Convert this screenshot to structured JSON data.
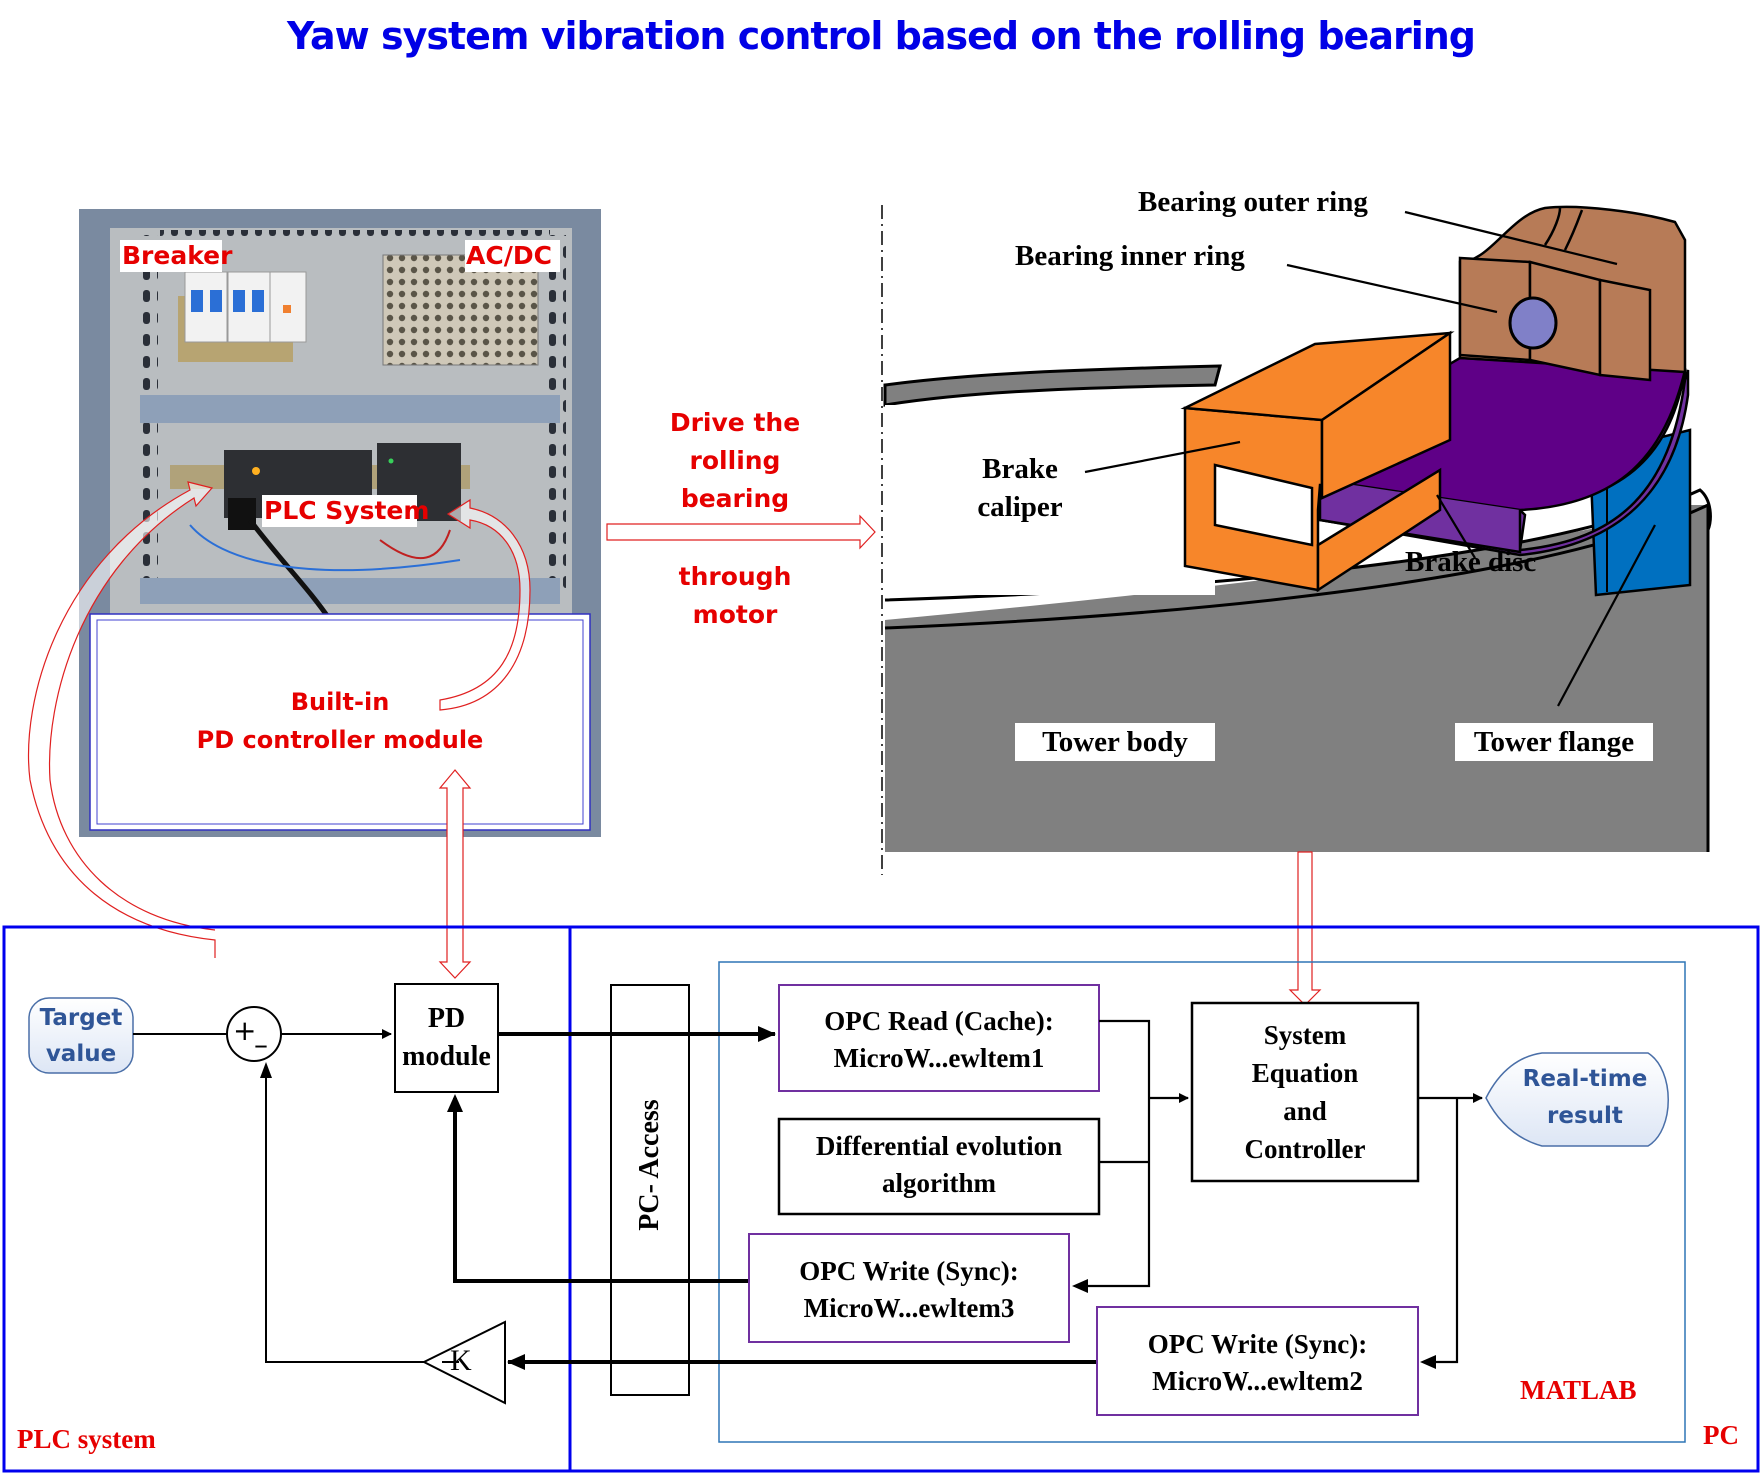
{
  "title": "Yaw system vibration control based on the rolling bearing",
  "photo": {
    "labels": {
      "breaker": "Breaker",
      "acdc": "AC/DC",
      "plc_system": "PLC System",
      "builtin_line1": "Built-in",
      "builtin_line2": "PD controller module"
    }
  },
  "middle_arrow": {
    "line1": "Drive the",
    "line2": "rolling",
    "line3": "bearing",
    "line4": "through",
    "line5": "motor"
  },
  "mechanism": {
    "labels": {
      "outer_ring": "Bearing outer ring",
      "inner_ring": "Bearing inner ring",
      "caliper_line1": "Brake",
      "caliper_line2": "caliper",
      "brake_disc": "Brake disc",
      "tower_body": "Tower body",
      "tower_flange": "Tower flange"
    },
    "colors": {
      "caliper": "#f7862a",
      "bearing": "#b77b57",
      "ball": "#8080c8",
      "disc_top": "#5f0087",
      "disc_side": "#7030a0",
      "flange": "#0070c0",
      "tower": "#808080"
    }
  },
  "block_diagram": {
    "plc_frame_label": "PLC system",
    "pc_frame_label": "PC",
    "matlab_frame_label": "MATLAB",
    "target_line1": "Target",
    "target_line2": "value",
    "sum_plus": "+",
    "sum_minus": "–",
    "pd_line1": "PD",
    "pd_line2": "module",
    "gain_label": "K",
    "pc_access": "PC- Access",
    "opc_read_line1": "OPC Read (Cache):",
    "opc_read_line2": "MicroW...ewltem1",
    "de_line1": "Differential evolution",
    "de_line2": "algorithm",
    "opc_write3_line1": "OPC Write (Sync):",
    "opc_write3_line2": "MicroW...ewltem3",
    "opc_write2_line1": "OPC Write (Sync):",
    "opc_write2_line2": "MicroW...ewltem2",
    "sys_line1": "System",
    "sys_line2": "Equation",
    "sys_line3": "and",
    "sys_line4": "Controller",
    "result_line1": "Real-time",
    "result_line2": "result",
    "colors": {
      "frame_blue": "#0000ee",
      "matlab_frame": "#2e75b6",
      "opc_border": "#7030a0",
      "label_red": "#e60000",
      "terminal_text": "#2f5597"
    }
  }
}
